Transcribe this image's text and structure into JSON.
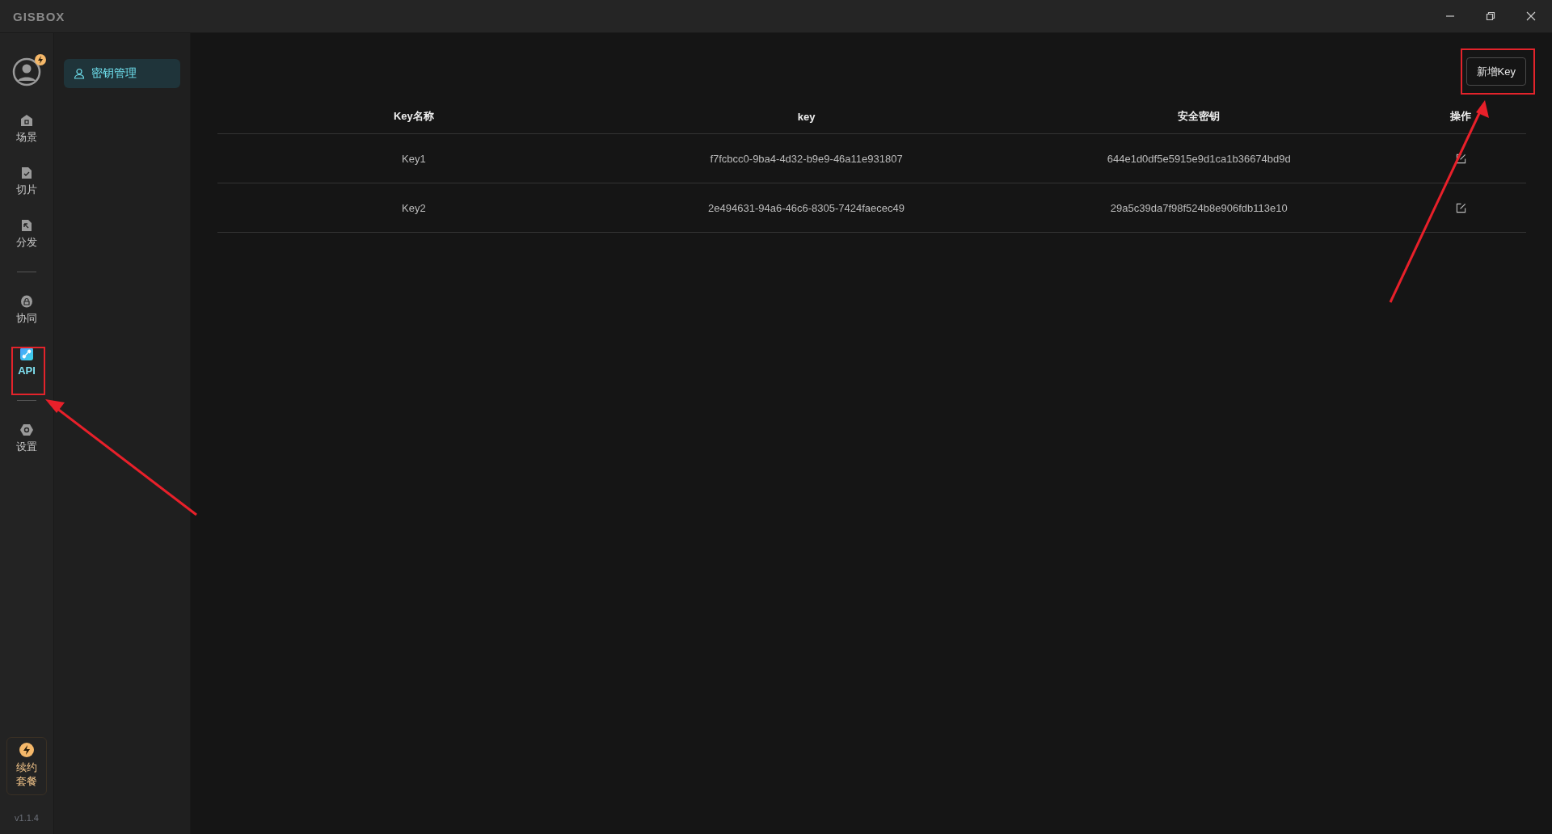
{
  "app": {
    "title": "GISBOX"
  },
  "nav": {
    "items": [
      {
        "kind": "home",
        "label": "场景",
        "selected": false
      },
      {
        "kind": "tiles",
        "label": "切片",
        "selected": false
      },
      {
        "kind": "publish",
        "label": "分发",
        "selected": false
      },
      {
        "kind": "divider"
      },
      {
        "kind": "collab",
        "label": "协同",
        "selected": false
      },
      {
        "kind": "api",
        "label": "API",
        "selected": true
      },
      {
        "kind": "divider"
      },
      {
        "kind": "settings",
        "label": "设置",
        "selected": false
      }
    ],
    "renew": {
      "lines": [
        "续约",
        "套餐"
      ]
    },
    "version": "v1.1.4"
  },
  "submenu": [
    {
      "label": "密钥管理",
      "selected": true
    }
  ],
  "toolbar": {
    "add_button": "新增Key"
  },
  "table": {
    "columns": [
      "Key名称",
      "key",
      "安全密钥",
      "操作"
    ],
    "rows": [
      {
        "name": "Key1",
        "key": "f7fcbcc0-9ba4-4d32-b9e9-46a11e931807",
        "secret": "644e1d0df5e5915e9d1ca1b36674bd9d"
      },
      {
        "name": "Key2",
        "key": "2e494631-94a6-46c6-8305-7424faecec49",
        "secret": "29a5c39da7f98f524b8e906fdb113e10"
      }
    ]
  }
}
